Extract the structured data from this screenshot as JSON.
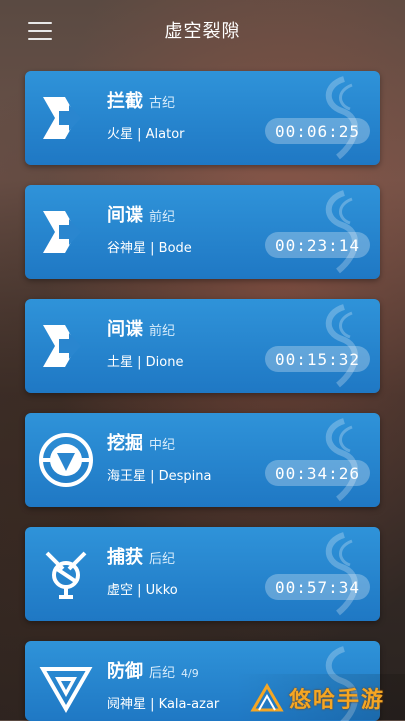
{
  "header": {
    "title": "虚空裂隙",
    "menu_icon": "hamburger-menu-icon"
  },
  "missions": [
    {
      "type": "拦截",
      "era": "古纪",
      "location": "火星 | Alator",
      "timer": "00:06:25",
      "icon": "interception-icon",
      "count": ""
    },
    {
      "type": "间谍",
      "era": "前纪",
      "location": "谷神星 | Bode",
      "timer": "00:23:14",
      "icon": "spy-icon",
      "count": ""
    },
    {
      "type": "间谍",
      "era": "前纪",
      "location": "土星 | Dione",
      "timer": "00:15:32",
      "icon": "spy-icon",
      "count": ""
    },
    {
      "type": "挖掘",
      "era": "中纪",
      "location": "海王星 | Despina",
      "timer": "00:34:26",
      "icon": "excavation-icon",
      "count": ""
    },
    {
      "type": "捕获",
      "era": "后纪",
      "location": "虚空 | Ukko",
      "timer": "00:57:34",
      "icon": "capture-icon",
      "count": ""
    },
    {
      "type": "防御",
      "era": "后纪",
      "location": "阋神星 | Kala-azar",
      "timer": "",
      "icon": "defense-icon",
      "count": "4/9"
    }
  ],
  "brand": {
    "text": "悠哈手游",
    "logo": "brand-logo-icon"
  },
  "colors": {
    "card_top": "#2f93d9",
    "card_bottom": "#1f78c4",
    "brand": "#f5a623"
  }
}
